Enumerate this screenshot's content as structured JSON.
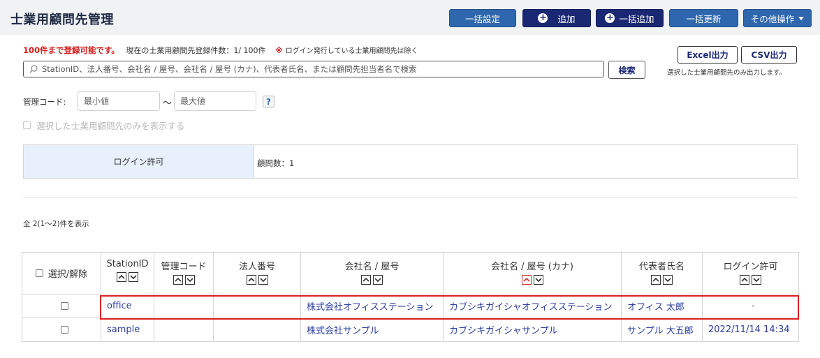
{
  "header": {
    "title": "士業用顧問先管理",
    "buttons": {
      "bulk_settings": "一括設定",
      "add": "追加",
      "bulk_add": "一括追加",
      "bulk_update": "一括更新",
      "other_ops": "その他操作"
    }
  },
  "info": {
    "limit_text": "100件まで登録可能です。",
    "current_count": "現在の士業用顧問先登録件数：1/ 100件",
    "note_mark": "※",
    "note": "ログイン発行している士業用顧問先は除く"
  },
  "search": {
    "placeholder": "StationID、法人番号、会社名 / 屋号、会社名 / 屋号 (カナ)、代表者氏名、または顧問先担当者名で検索",
    "button": "検索"
  },
  "export": {
    "excel": "Excel出力",
    "csv": "CSV出力",
    "note": "選択した士業用顧問先のみ出力します。"
  },
  "filter": {
    "code_label": "管理コード:",
    "min_placeholder": "最小値",
    "tilde": "～",
    "max_placeholder": "最大値",
    "help": "?",
    "only_selected": "選択した士業用顧問先のみを表示する"
  },
  "stats": {
    "login_label": "ログイン許可",
    "advisor_count": "顧問数：1"
  },
  "list": {
    "count_text": "全 2(1～2)件を表示",
    "headers": [
      "選択/解除",
      "StationID",
      "管理コード",
      "法人番号",
      "会社名 / 屋号",
      "会社名 / 屋号 (カナ)",
      "代表者氏名",
      "ログイン許可"
    ],
    "rows": [
      {
        "station_id": "office",
        "code": "",
        "corp_no": "",
        "company": "株式会社オフィスステーション",
        "company_kana": "カブシキガイシャオフィスステーション",
        "rep": "オフィス 太郎",
        "login": "-"
      },
      {
        "station_id": "sample",
        "code": "",
        "corp_no": "",
        "company": "株式会社サンプル",
        "company_kana": "カブシキガイシャサンプル",
        "rep": "サンプル 大五郎",
        "login": "2022/11/14 14:34"
      }
    ]
  },
  "colors": {
    "btn_blue": "#2e67ad",
    "btn_navy": "#1a2773",
    "link": "#2b3fa0",
    "alert_red": "#d61a1a",
    "highlight": "#e02020"
  }
}
